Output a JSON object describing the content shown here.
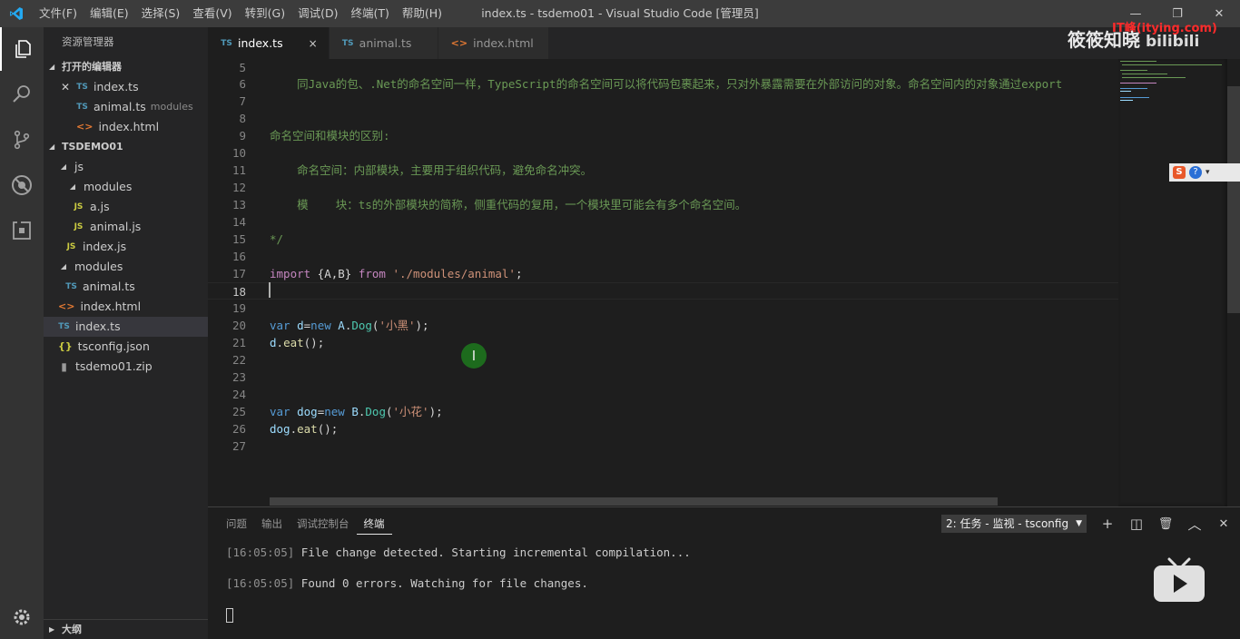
{
  "window": {
    "title": "index.ts - tsdemo01 - Visual Studio Code [管理员]",
    "menu": [
      "文件(F)",
      "编辑(E)",
      "选择(S)",
      "查看(V)",
      "转到(G)",
      "调试(D)",
      "终端(T)",
      "帮助(H)"
    ],
    "controls": {
      "minimize": "—",
      "restore": "❐",
      "close": "✕"
    }
  },
  "sidebar": {
    "title": "资源管理器",
    "open_editors": {
      "header": "打开的编辑器",
      "items": [
        {
          "icon": "TS",
          "name": "index.ts",
          "hint": ""
        },
        {
          "icon": "TS",
          "name": "animal.ts",
          "hint": "modules"
        },
        {
          "icon": "<>",
          "name": "index.html",
          "hint": ""
        }
      ]
    },
    "project": {
      "header": "TSDEMO01",
      "items": [
        {
          "icon": "",
          "name": "js"
        },
        {
          "icon": "",
          "name": "modules"
        },
        {
          "icon": "JS",
          "name": "a.js"
        },
        {
          "icon": "JS",
          "name": "animal.js"
        },
        {
          "icon": "JS",
          "name": "index.js"
        },
        {
          "icon": "",
          "name": "modules"
        },
        {
          "icon": "TS",
          "name": "animal.ts"
        },
        {
          "icon": "<>",
          "name": "index.html"
        },
        {
          "icon": "TS",
          "name": "index.ts"
        },
        {
          "icon": "{}",
          "name": "tsconfig.json"
        },
        {
          "icon": "",
          "name": "tsdemo01.zip"
        }
      ]
    },
    "outline": {
      "header": "大纲"
    }
  },
  "tabs": [
    {
      "icon": "TS",
      "label": "index.ts",
      "close": "×"
    },
    {
      "icon": "TS",
      "label": "animal.ts"
    },
    {
      "icon": "<>",
      "label": "index.html"
    }
  ],
  "editor": {
    "line_numbers": [
      "5",
      "6",
      "7",
      "8",
      "9",
      "10",
      "11",
      "12",
      "13",
      "14",
      "15",
      "16",
      "17",
      "18",
      "19",
      "20",
      "21",
      "22",
      "23",
      "24",
      "25",
      "26",
      "27"
    ],
    "comments": {
      "l6": "    同Java的包、.Net的命名空间一样，TypeScript的命名空间可以将代码包裹起来，只对外暴露需要在外部访问的对象。命名空间内的对象通过export",
      "l9": "命名空间和模块的区别:",
      "l11": "    命名空间：内部模块，主要用于组织代码，避免命名冲突。",
      "l13": "    模    块：ts的外部模块的简称，侧重代码的复用，一个模块里可能会有多个命名空间。",
      "l15": "*/"
    },
    "l17": {
      "kw": "import",
      "mid": " {A,B} ",
      "from": "from",
      "path": "'./modules/animal'",
      "end": ";"
    },
    "l20": {
      "var": "var",
      "name": "d",
      "eq": "=",
      "new": "new",
      "obj": "A",
      "dot": ".",
      "cls": "Dog",
      "open": "(",
      "arg": "'小黑'",
      "close": ");"
    },
    "l21": {
      "obj": "d",
      "dot": ".",
      "fn": "eat",
      "rest": "();"
    },
    "l25": {
      "var": "var",
      "name": "dog",
      "eq": "=",
      "new": "new",
      "obj": "B",
      "dot": ".",
      "cls": "Dog",
      "open": "(",
      "arg": "'小花'",
      "close": ");"
    },
    "l26": {
      "obj": "dog",
      "dot": ".",
      "fn": "eat",
      "rest": "();"
    },
    "mouse_cursor": "I"
  },
  "panel": {
    "tabs": [
      "问题",
      "输出",
      "调试控制台",
      "终端"
    ],
    "task_select": "2: 任务 - 监视 - tsconfig",
    "task_arrow": "▼",
    "buttons": {
      "add": "+",
      "split": "◫",
      "trash": "🗑",
      "maximize": "︿",
      "close": "✕"
    },
    "terminal": [
      {
        "time": "[16:05:05]",
        "text": " File change detected. Starting incremental compilation..."
      },
      {
        "time": "[16:05:05]",
        "text": " Found 0 errors. Watching for file changes."
      }
    ]
  },
  "overlay": {
    "watermark_text": "筱筱知晓",
    "watermark_bili": "bilibili",
    "red_logo": "IT峰(itying.com)",
    "ime_logo": "S"
  }
}
